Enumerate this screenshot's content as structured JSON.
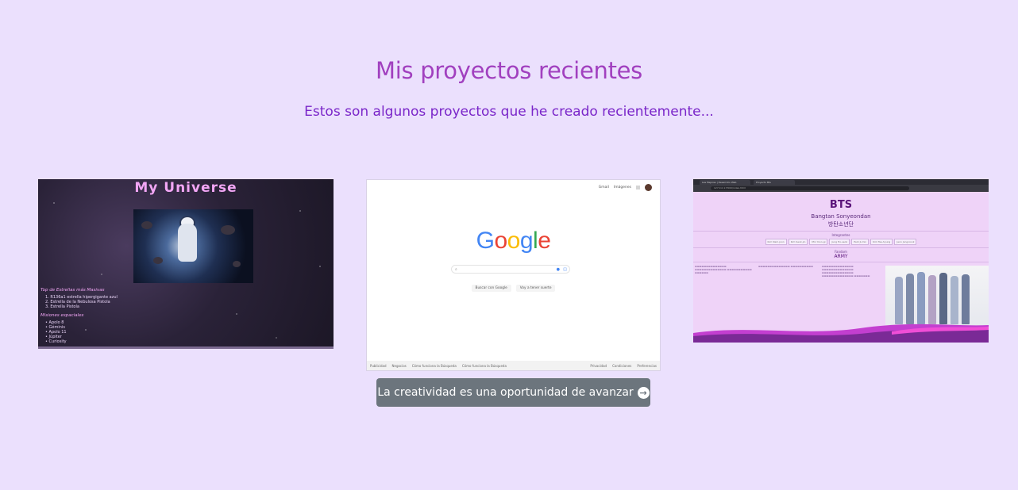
{
  "header": {
    "title": "Mis proyectos recientes",
    "subtitle": "Estos son algunos proyectos que he creado recientemente..."
  },
  "projects": [
    {
      "name": "my-universe",
      "heading": "My Universe",
      "list_title": "Top de Estrellas más Masivas",
      "list_items": [
        "1. R136a1 estrella hipergigante azul",
        "2. Estrella de la Nebulosa Pistola",
        "3. Estrella Pistola"
      ],
      "missions_title": "Misiones espaciales",
      "missions": [
        "Apolo 8",
        "Géminis",
        "Apolo 11",
        "Júpiter",
        "Curiosity"
      ]
    },
    {
      "name": "google-clone",
      "top_links": [
        "Gmail",
        "Imágenes"
      ],
      "logo_letters": [
        "G",
        "o",
        "o",
        "g",
        "l",
        "e"
      ],
      "logo_colors": [
        "#4285f4",
        "#ea4335",
        "#fbbc05",
        "#4285f4",
        "#34a853",
        "#ea4335"
      ],
      "buttons": [
        "Buscar con Google",
        "Voy a tener suerte"
      ],
      "footer_left": [
        "Publicidad",
        "Negocios",
        "Cómo funciona la Búsqueda",
        "Cómo funciona la Búsqueda"
      ],
      "footer_right": [
        "Privacidad",
        "Condiciones",
        "Preferencias"
      ]
    },
    {
      "name": "bts-page",
      "tabs": [
        "Las Mejores | Desarrollo Web",
        "Proyecto Bts"
      ],
      "address": "127.0.0.1:5500/index.html",
      "title": "BTS",
      "subtitle": "Bangtan Sonyeondan",
      "korean": "방탄소년단",
      "members_title": "Integrantes",
      "members": [
        "Kim Nam-joon",
        "Kim Seok-jin",
        "Min Yoon-gi",
        "Jung Ho-seok",
        "Park Ji-min",
        "Kim Tae-hyung",
        "Jeon Jung-kook"
      ],
      "fandom_title": "Fandom",
      "fandom": "ARMY"
    }
  ],
  "cta": {
    "label": "La creatividad es una oportunidad de avanzar",
    "icon": "arrow-right-circle-icon"
  },
  "colors": {
    "background": "#ebe0fd",
    "title": "#a140bf",
    "subtitle": "#7a26c9",
    "button": "#6c757d"
  }
}
